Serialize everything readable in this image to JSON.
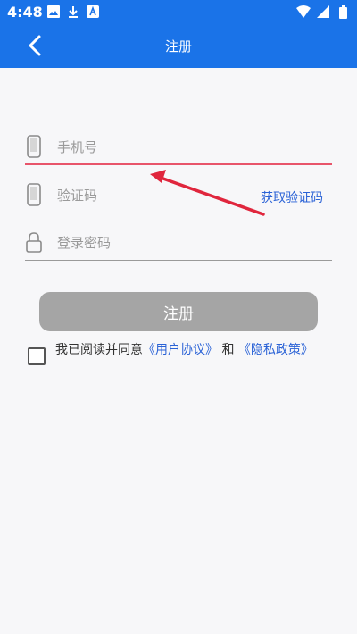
{
  "status_bar": {
    "time": "4:48",
    "left_icons": [
      "image-icon",
      "download-icon",
      "app-icon"
    ],
    "right_icons": [
      "wifi-icon",
      "signal-icon",
      "battery-icon"
    ]
  },
  "app_bar": {
    "title": "注册",
    "back_icon": "chevron-left-icon"
  },
  "form": {
    "phone_placeholder": "手机号",
    "code_placeholder": "验证码",
    "get_code_label": "获取验证码",
    "password_placeholder": "登录密码",
    "submit_label": "注册"
  },
  "agreement": {
    "prefix": "我已阅读并同意",
    "user_agreement": "《用户协议》",
    "conjunction": " 和 ",
    "privacy_policy": "《隐私政策》",
    "checked": false
  },
  "colors": {
    "primary": "#1a73e8",
    "active_underline": "#e8556b",
    "link": "#2a62d6",
    "button_disabled": "#a5a5a5",
    "arrow": "#e0263d"
  }
}
